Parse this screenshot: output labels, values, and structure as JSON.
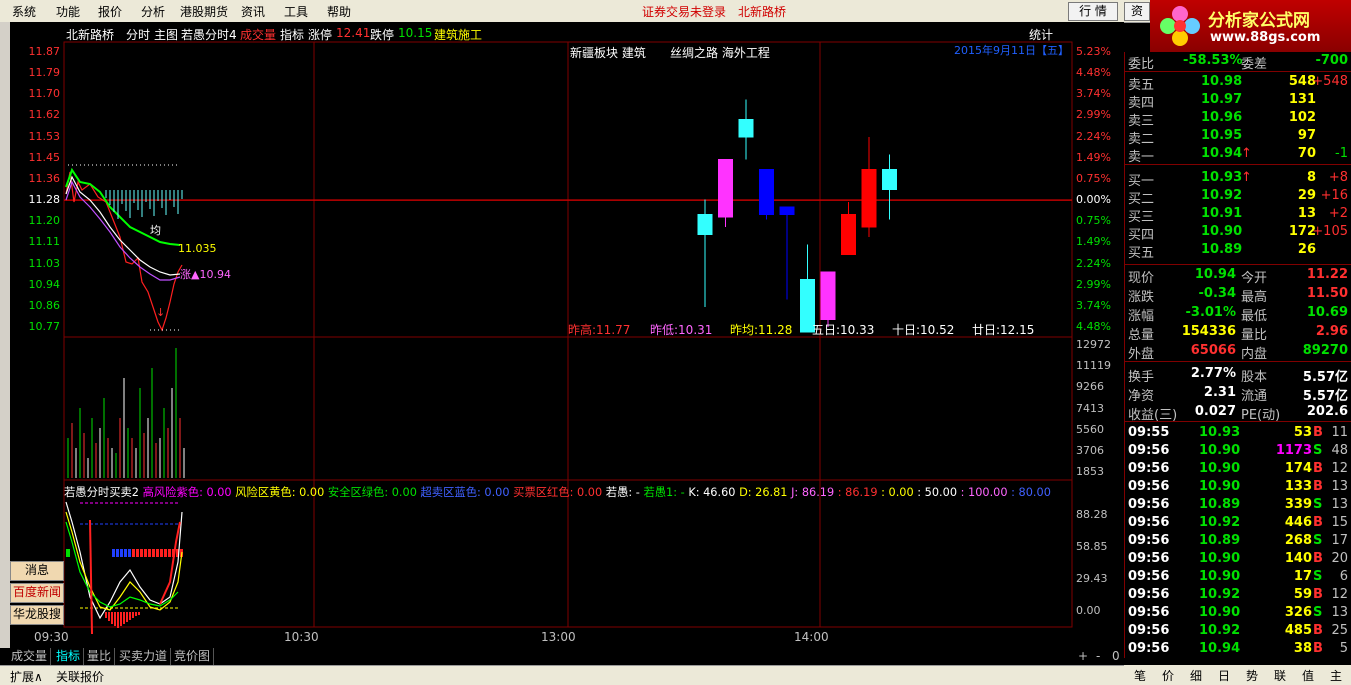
{
  "menu": {
    "items": [
      "系统",
      "功能",
      "报价",
      "分析",
      "港股期货",
      "资讯",
      "工具",
      "帮助"
    ],
    "status_login": "证券交易未登录",
    "stock_name": "北新路桥",
    "btn_quote": "行 情",
    "btn_info": "资"
  },
  "logo": {
    "title": "分析家公式网",
    "url": "www.88gs.com"
  },
  "header": {
    "name": "北新路桥",
    "mode": "分时",
    "main": "主图",
    "formula": "若愚分时4",
    "cj": "成交量",
    "zb": "指标",
    "zt_label": "涨停",
    "zt_val": "12.41",
    "dt_label": "跌停",
    "dt_val": "10.15",
    "sector": "建筑施工",
    "stats": "统计",
    "date": "2015年9月11日【五】"
  },
  "concepts": {
    "a": "新疆板块 建筑",
    "b": "丝绸之路 海外工程"
  },
  "price_axis": [
    "11.87",
    "11.79",
    "11.70",
    "11.62",
    "11.53",
    "11.45",
    "11.36",
    "11.28",
    "11.20",
    "11.11",
    "11.03",
    "10.94",
    "10.86",
    "10.77"
  ],
  "pct_axis": [
    "5.23%",
    "4.48%",
    "3.74%",
    "2.99%",
    "2.24%",
    "1.49%",
    "0.75%",
    "0.00%",
    "0.75%",
    "1.49%",
    "2.24%",
    "2.99%",
    "3.74%",
    "4.48%"
  ],
  "vol_axis": [
    "12972",
    "11119",
    "9266",
    "7413",
    "5560",
    "3706",
    "1853"
  ],
  "ind_axis": [
    "88.28",
    "58.85",
    "29.43",
    "0.00"
  ],
  "annot": {
    "avg": "均",
    "avgval": "11.035",
    "rise": "涨▲10.94",
    "low": "↓"
  },
  "hist": {
    "zg": "昨高:11.77",
    "zd": "昨低:10.31",
    "zj": "昨均:11.28",
    "d5": "五日:10.33",
    "d10": "十日:10.52",
    "d20": "廿日:12.15"
  },
  "ind_header": {
    "name": "若愚分时买卖2",
    "a": "高风险紫色: 0.00",
    "b": "风险区黄色: 0.00",
    "c": "安全区绿色: 0.00",
    "d": "超卖区蓝色: 0.00",
    "e": "买票区红色: 0.00",
    "f": "若愚: -",
    "g": "若愚1: -",
    "k": "K: 46.60",
    "dv": "D: 26.81",
    "j": "J: 86.19",
    "x1": ": 86.19",
    "x2": ": 0.00",
    "x3": ": 50.00",
    "x4": ": 100.00",
    "x5": ": 80.00"
  },
  "time_axis": [
    "09:30",
    "10:30",
    "13:00",
    "14:00"
  ],
  "side_buttons": [
    "消息",
    "百度新闻",
    "华龙股搜"
  ],
  "tabs": [
    "成交量",
    "指标",
    "量比",
    "买卖力道",
    "竞价图"
  ],
  "tab_ctrl": [
    "+",
    "-",
    "0"
  ],
  "status": [
    "扩展∧",
    "关联报价"
  ],
  "rtabs": [
    "笔",
    "价",
    "细",
    "日",
    "势",
    "联",
    "值",
    "主"
  ],
  "orderbook": {
    "wb_label": "委比",
    "wb": "-58.53%",
    "wc_label": "委差",
    "wc": "-700",
    "sell": [
      {
        "l": "卖五",
        "p": "10.98",
        "v": "548",
        "c": "+548"
      },
      {
        "l": "卖四",
        "p": "10.97",
        "v": "131",
        "c": ""
      },
      {
        "l": "卖三",
        "p": "10.96",
        "v": "102",
        "c": ""
      },
      {
        "l": "卖二",
        "p": "10.95",
        "v": "97",
        "c": ""
      },
      {
        "l": "卖一",
        "p": "10.94",
        "v": "70",
        "c": "-1",
        "arrow": "↑"
      }
    ],
    "buy": [
      {
        "l": "买一",
        "p": "10.93",
        "v": "8",
        "c": "+8",
        "arrow": "↑"
      },
      {
        "l": "买二",
        "p": "10.92",
        "v": "29",
        "c": "+16"
      },
      {
        "l": "买三",
        "p": "10.91",
        "v": "13",
        "c": "+2"
      },
      {
        "l": "买四",
        "p": "10.90",
        "v": "172",
        "c": "+105"
      },
      {
        "l": "买五",
        "p": "10.89",
        "v": "26",
        "c": ""
      }
    ]
  },
  "quote": [
    {
      "l1": "现价",
      "v1": "10.94",
      "l2": "今开",
      "v2": "11.22"
    },
    {
      "l1": "涨跌",
      "v1": "-0.34",
      "l2": "最高",
      "v2": "11.50"
    },
    {
      "l1": "涨幅",
      "v1": "-3.01%",
      "l2": "最低",
      "v2": "10.69"
    },
    {
      "l1": "总量",
      "v1": "154336",
      "l2": "量比",
      "v2": "2.96"
    },
    {
      "l1": "外盘",
      "v1": "65066",
      "l2": "内盘",
      "v2": "89270"
    },
    {
      "l1": "换手",
      "v1": "2.77%",
      "l2": "股本",
      "v2": "5.57亿"
    },
    {
      "l1": "净资",
      "v1": "2.31",
      "l2": "流通",
      "v2": "5.57亿"
    },
    {
      "l1": "收益(三)",
      "v1": "0.027",
      "l2": "PE(动)",
      "v2": "202.6"
    }
  ],
  "ticks": [
    {
      "t": "09:55",
      "p": "10.93",
      "v": "53",
      "s": "B",
      "n": "11"
    },
    {
      "t": "09:56",
      "p": "10.90",
      "v": "1173",
      "s": "S",
      "n": "48"
    },
    {
      "t": "09:56",
      "p": "10.90",
      "v": "174",
      "s": "B",
      "n": "12"
    },
    {
      "t": "09:56",
      "p": "10.90",
      "v": "133",
      "s": "B",
      "n": "13"
    },
    {
      "t": "09:56",
      "p": "10.89",
      "v": "339",
      "s": "S",
      "n": "13"
    },
    {
      "t": "09:56",
      "p": "10.92",
      "v": "446",
      "s": "B",
      "n": "15"
    },
    {
      "t": "09:56",
      "p": "10.89",
      "v": "268",
      "s": "S",
      "n": "17"
    },
    {
      "t": "09:56",
      "p": "10.90",
      "v": "140",
      "s": "B",
      "n": "20"
    },
    {
      "t": "09:56",
      "p": "10.90",
      "v": "17",
      "s": "S",
      "n": "6"
    },
    {
      "t": "09:56",
      "p": "10.92",
      "v": "59",
      "s": "B",
      "n": "12"
    },
    {
      "t": "09:56",
      "p": "10.90",
      "v": "326",
      "s": "S",
      "n": "13"
    },
    {
      "t": "09:56",
      "p": "10.92",
      "v": "485",
      "s": "B",
      "n": "25"
    },
    {
      "t": "09:56",
      "p": "10.94",
      "v": "38",
      "s": "B",
      "n": "5"
    }
  ],
  "colors": {
    "up": "#ff3030",
    "down": "#00e000",
    "neutral": "#ffffff",
    "yellow": "#ffff00",
    "cyan": "#00ffff",
    "magenta": "#ff00ff",
    "grid": "#800000"
  },
  "candles": [
    {
      "o": 11.14,
      "c": 11.22,
      "h": 11.28,
      "l": 10.85
    },
    {
      "o": 11.21,
      "c": 11.44,
      "h": 11.44,
      "l": 11.17
    },
    {
      "o": 11.53,
      "c": 11.6,
      "h": 11.68,
      "l": 11.44
    },
    {
      "o": 11.4,
      "c": 11.22,
      "h": 11.4,
      "l": 11.2
    },
    {
      "o": 11.25,
      "c": 11.22,
      "h": 11.25,
      "l": 10.88
    },
    {
      "o": 10.96,
      "c": 10.75,
      "h": 11.1,
      "l": 10.75
    },
    {
      "o": 10.8,
      "c": 10.99,
      "h": 10.99,
      "l": 10.77
    },
    {
      "o": 11.06,
      "c": 11.22,
      "h": 11.27,
      "l": 11.06
    },
    {
      "o": 11.17,
      "c": 11.4,
      "h": 11.53,
      "l": 11.13
    },
    {
      "o": 11.32,
      "c": 11.4,
      "h": 11.46,
      "l": 11.2
    }
  ]
}
